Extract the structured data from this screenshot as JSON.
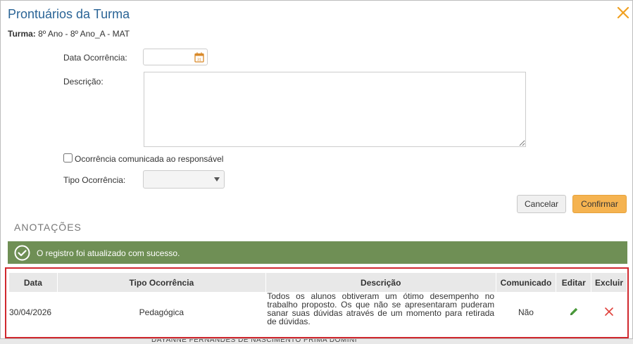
{
  "modal": {
    "title": "Prontuários da Turma",
    "turma_label": "Turma:",
    "turma_value": "8º Ano - 8º Ano_A - MAT"
  },
  "form": {
    "data_label": "Data Ocorrência:",
    "data_value": "",
    "descricao_label": "Descrição:",
    "descricao_value": "",
    "comunicada_label": "Ocorrência comunicada ao responsável",
    "comunicada_checked": false,
    "tipo_label": "Tipo Ocorrência:",
    "tipo_value": ""
  },
  "buttons": {
    "cancel": "Cancelar",
    "confirm": "Confirmar"
  },
  "section_title": "ANOTAÇÕES",
  "alert": {
    "message": "O registro foi atualizado com sucesso.",
    "color": "#6f8f55"
  },
  "table": {
    "headers": {
      "data": "Data",
      "tipo": "Tipo Ocorrência",
      "descricao": "Descrição",
      "comunicado": "Comunicado",
      "editar": "Editar",
      "excluir": "Excluir"
    },
    "rows": [
      {
        "data": "30/04/2026",
        "tipo": "Pedagógica",
        "descricao": "Todos os alunos obtiveram um ótimo desempenho no trabalho proposto. Os que não se apresentaram puderam sanar suas dúvidas através de um momento para retirada de dúvidas.",
        "comunicado": "Não"
      }
    ]
  },
  "background": {
    "behind_text": "DAYANNE FERNANDES DE NASCIMENTO PRIMA DOMINI"
  },
  "colors": {
    "title": "#2a6496",
    "close": "#f0a020",
    "confirm": "#f5b350",
    "highlight_border": "#d0282e",
    "edit_icon": "#4a9a3a",
    "delete_icon": "#e0403a"
  },
  "icons": {
    "close": "close-icon",
    "calendar": "calendar-icon",
    "caret": "chevron-down-icon",
    "success": "check-circle-icon",
    "edit": "pencil-icon",
    "delete": "x-icon"
  }
}
